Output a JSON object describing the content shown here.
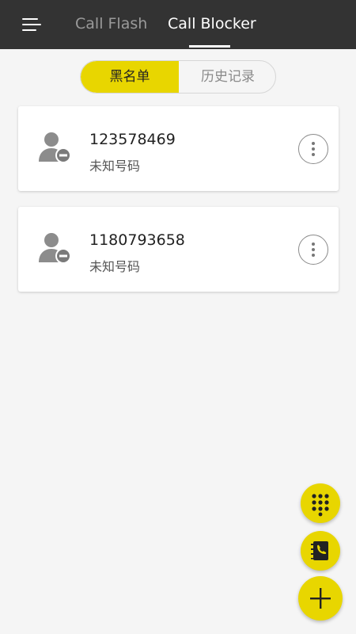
{
  "header": {
    "tabs": [
      {
        "label": "Call Flash",
        "active": false
      },
      {
        "label": "Call Blocker",
        "active": true
      }
    ]
  },
  "segment": {
    "options": [
      {
        "label": "黑名单",
        "selected": true
      },
      {
        "label": "历史记录",
        "selected": false
      }
    ]
  },
  "entries": [
    {
      "number": "123578469",
      "label": "未知号码"
    },
    {
      "number": "1180793658",
      "label": "未知号码"
    }
  ],
  "icons": {
    "menu": "menu-icon",
    "avatar": "blocked-contact-icon",
    "more": "more-vertical-icon",
    "dialpad": "dialpad-icon",
    "contacts": "contact-book-icon",
    "add": "plus-icon"
  },
  "colors": {
    "accent": "#e8d600",
    "topbar": "#333333",
    "background": "#f5f5f5"
  }
}
